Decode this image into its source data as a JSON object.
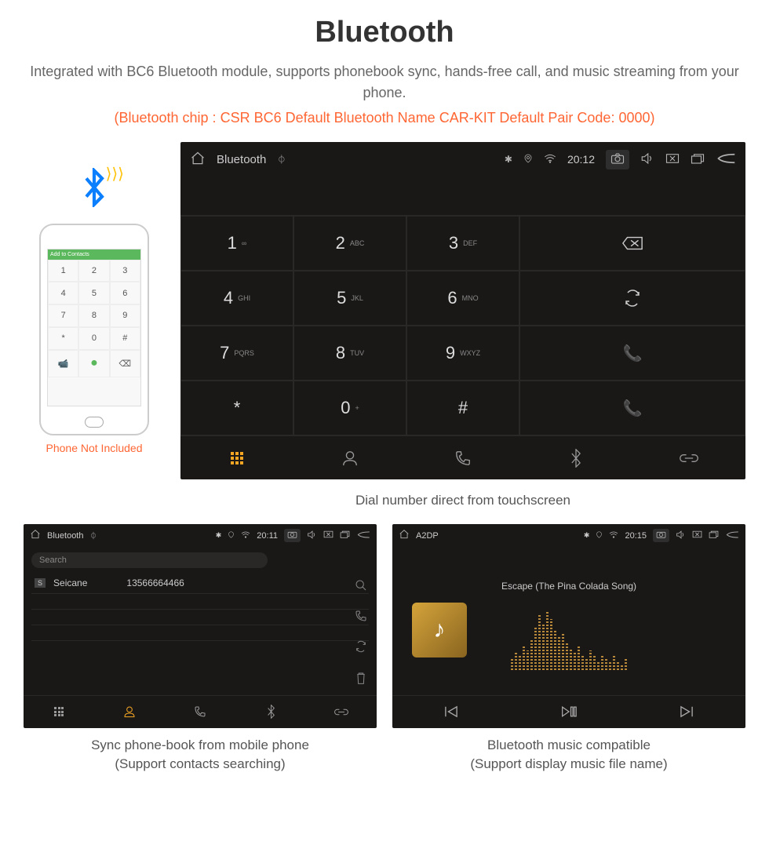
{
  "title": "Bluetooth",
  "subtitle": "Integrated with BC6 Bluetooth module, supports phonebook sync, hands-free call, and music streaming from your phone.",
  "specs": "(Bluetooth chip : CSR BC6     Default Bluetooth Name CAR-KIT     Default Pair Code: 0000)",
  "phone": {
    "topbar": "Add to Contacts",
    "note": "Phone Not Included"
  },
  "main_unit": {
    "app": "Bluetooth",
    "time": "20:12",
    "keys": [
      {
        "n": "1",
        "l": "∞"
      },
      {
        "n": "2",
        "l": "ABC"
      },
      {
        "n": "3",
        "l": "DEF"
      },
      {
        "n": "4",
        "l": "GHI"
      },
      {
        "n": "5",
        "l": "JKL"
      },
      {
        "n": "6",
        "l": "MNO"
      },
      {
        "n": "7",
        "l": "PQRS"
      },
      {
        "n": "8",
        "l": "TUV"
      },
      {
        "n": "9",
        "l": "WXYZ"
      },
      {
        "n": "*",
        "l": ""
      },
      {
        "n": "0",
        "l": "+"
      },
      {
        "n": "#",
        "l": ""
      }
    ],
    "caption": "Dial number direct from touchscreen"
  },
  "contacts_unit": {
    "app": "Bluetooth",
    "time": "20:11",
    "search": "Search",
    "badge": "S",
    "name": "Seicane",
    "number": "13566664466",
    "caption1": "Sync phone-book from mobile phone",
    "caption2": "(Support contacts searching)"
  },
  "music_unit": {
    "app": "A2DP",
    "time": "20:15",
    "track": "Escape (The Pina Colada Song)",
    "caption1": "Bluetooth music compatible",
    "caption2": "(Support display music file name)"
  }
}
